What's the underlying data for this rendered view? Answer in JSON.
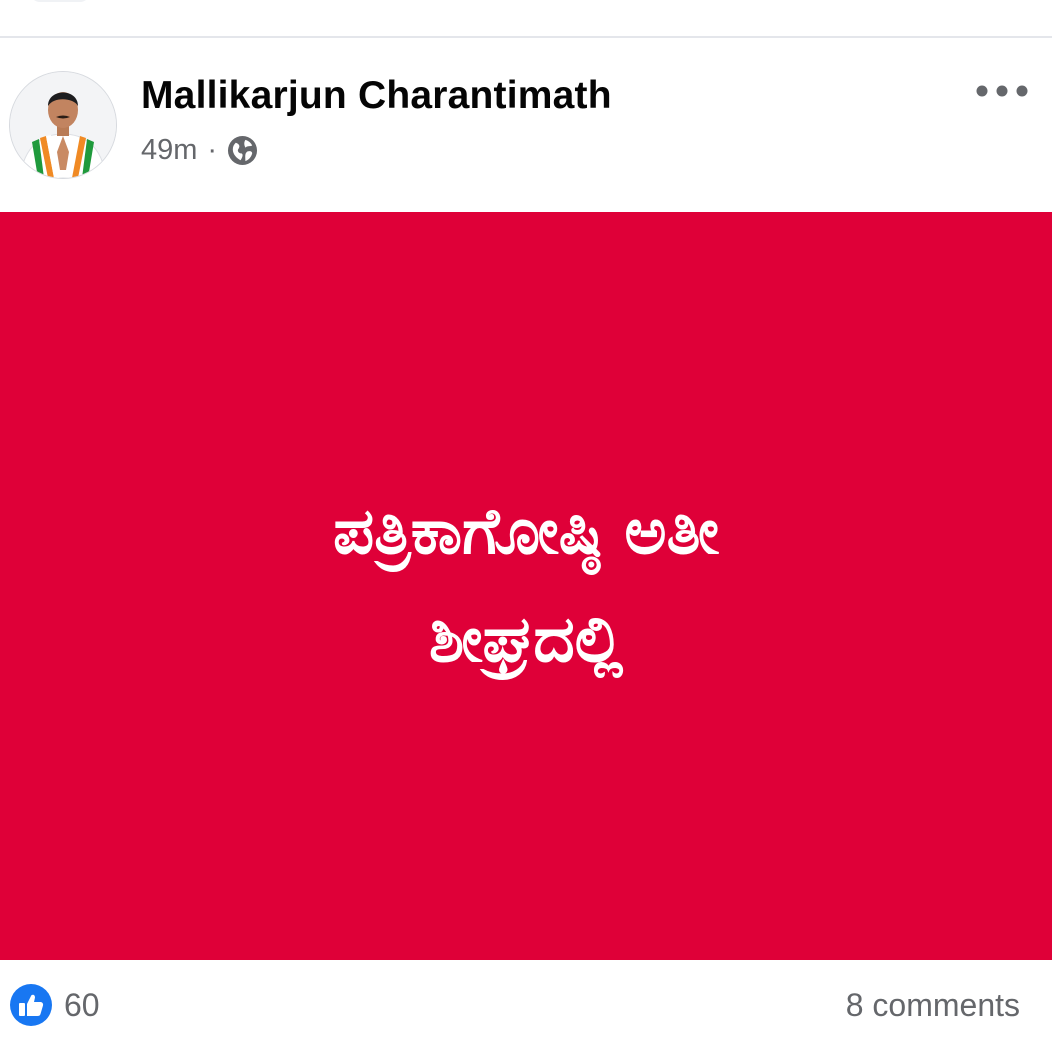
{
  "post": {
    "author_name": "Mallikarjun Charantimath",
    "timestamp": "49m",
    "separator": "·",
    "privacy_icon": "globe-icon",
    "more_icon": "more-options-icon",
    "image": {
      "background_color": "#df0038",
      "text_line1": "ಪತ್ರಿಕಾಗೋಷ್ಠಿ ಅತೀ",
      "text_line2": "ಶೀಘ್ರದಲ್ಲಿ"
    },
    "reactions": {
      "icon": "like-icon",
      "count": "60"
    },
    "comments_label": "8 comments"
  },
  "colors": {
    "accent": "#1877f2",
    "secondary_text": "#65676b",
    "primary_text": "#050505"
  }
}
